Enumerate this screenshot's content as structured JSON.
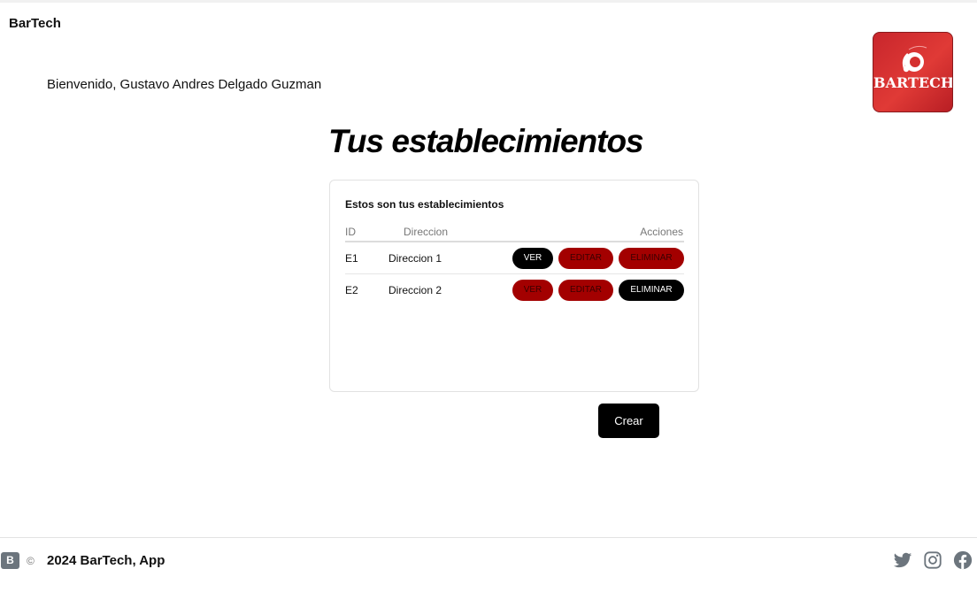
{
  "header": {
    "brand": "BarTech",
    "logo_text": "BARTECH"
  },
  "welcome": "Bienvenido, Gustavo Andres Delgado Guzman",
  "page_title": "Tus establecimientos",
  "card": {
    "title": "Estos son tus establecimientos",
    "columns": {
      "id": "ID",
      "direccion": "Direccion",
      "acciones": "Acciones"
    },
    "rows": [
      {
        "id": "E1",
        "direccion": "Direccion 1",
        "ver": "VER",
        "editar": "EDITAR",
        "eliminar": "ELIMINAR"
      },
      {
        "id": "E2",
        "direccion": "Direccion 2",
        "ver": "VER",
        "editar": "EDITAR",
        "eliminar": "ELIMINAR"
      }
    ]
  },
  "create_button": "Crear",
  "footer": {
    "copyright_symbol": "©",
    "text": "2024 BarTech, App",
    "bootstrap_letter": "B",
    "icons": [
      "bootstrap-icon",
      "twitter-icon",
      "instagram-icon",
      "facebook-icon"
    ]
  },
  "colors": {
    "accent_red": "#a30000",
    "dark": "#000000",
    "logo_red": "#d4302f"
  }
}
